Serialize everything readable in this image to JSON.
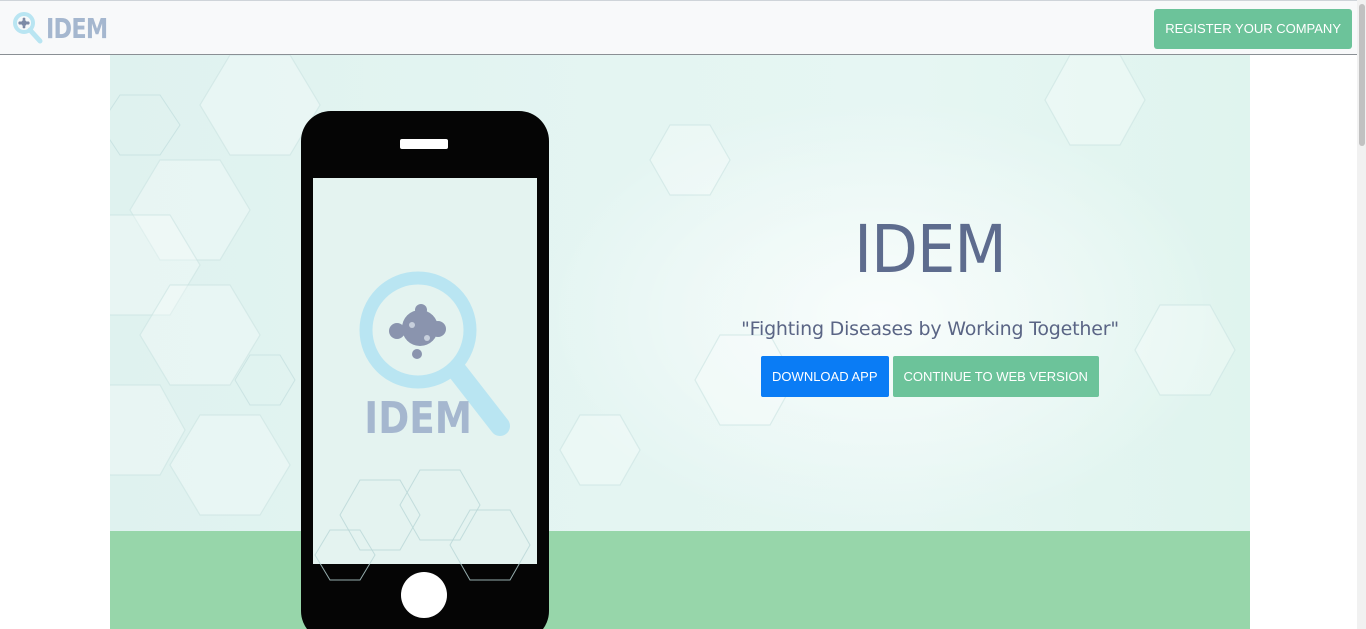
{
  "navbar": {
    "brand": "IDEM",
    "register_button": "REGISTER YOUR COMPANY"
  },
  "hero": {
    "title": "IDEM",
    "tagline": "\"Fighting Diseases by Working Together\"",
    "download_button": "DOWNLOAD APP",
    "web_button": "CONTINUE TO WEB VERSION",
    "phone_logo_text": "IDEM"
  },
  "colors": {
    "brand_green": "#6cc39a",
    "primary_blue": "#0a7cf5",
    "title_color": "#5e6c8e",
    "band_green": "#97d6aa",
    "logo_blue": "#a5b7cf",
    "logo_ring": "#b9e5f2"
  },
  "icons": {
    "brand": "magnifier-virus-icon",
    "phone_logo": "magnifier-virus-icon"
  }
}
